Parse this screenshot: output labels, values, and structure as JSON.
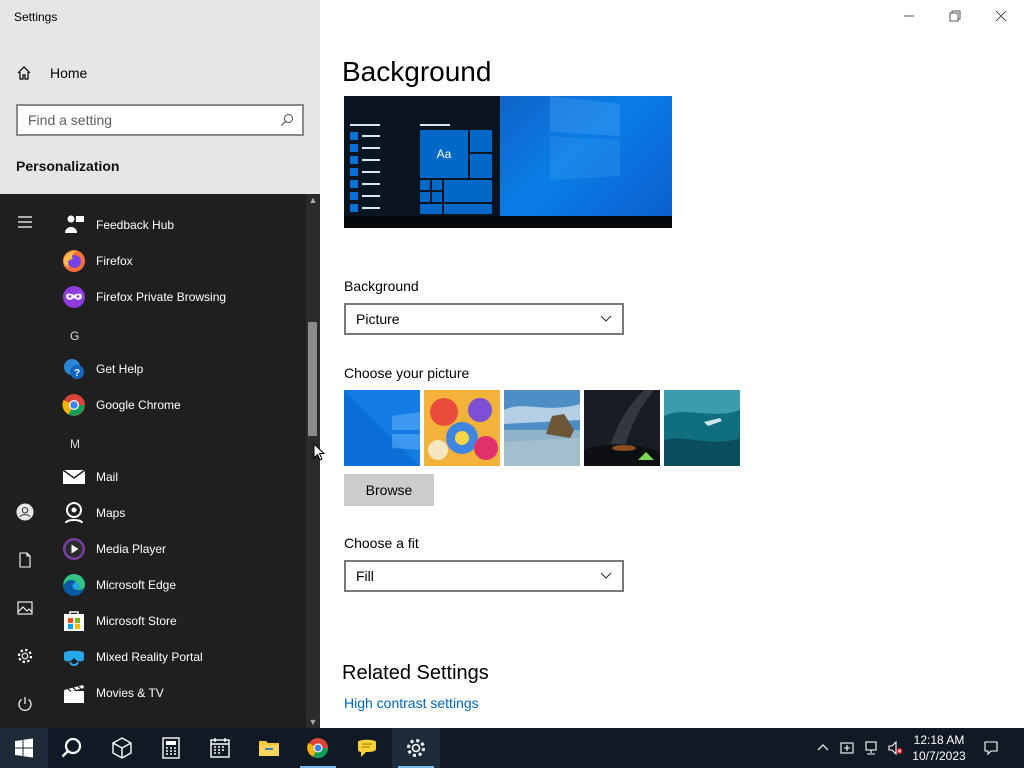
{
  "window": {
    "title": "Settings"
  },
  "sidebar": {
    "home_label": "Home",
    "search_placeholder": "Find a setting",
    "section_label": "Personalization"
  },
  "start_menu": {
    "apps": [
      {
        "name": "Feedback Hub",
        "icon": "feedback-hub-icon"
      },
      {
        "name": "Firefox",
        "icon": "firefox-icon"
      },
      {
        "name": "Firefox Private Browsing",
        "icon": "firefox-private-icon"
      },
      {
        "name": "Get Help",
        "icon": "get-help-icon"
      },
      {
        "name": "Google Chrome",
        "icon": "chrome-icon"
      },
      {
        "name": "Mail",
        "icon": "mail-icon"
      },
      {
        "name": "Maps",
        "icon": "maps-icon"
      },
      {
        "name": "Media Player",
        "icon": "media-player-icon"
      },
      {
        "name": "Microsoft Edge",
        "icon": "edge-icon"
      },
      {
        "name": "Microsoft Store",
        "icon": "store-icon"
      },
      {
        "name": "Mixed Reality Portal",
        "icon": "mixed-reality-icon"
      },
      {
        "name": "Movies & TV",
        "icon": "movies-tv-icon"
      }
    ],
    "letters": [
      "G",
      "M"
    ]
  },
  "main": {
    "page_title": "Background",
    "background_label": "Background",
    "background_value": "Picture",
    "choose_picture_label": "Choose your picture",
    "browse_label": "Browse",
    "choose_fit_label": "Choose a fit",
    "fit_value": "Fill",
    "related_heading": "Related Settings",
    "high_contrast_link": "High contrast settings",
    "preview_tile_text": "Aa"
  },
  "taskbar": {
    "time": "12:18 AM",
    "date": "10/7/2023"
  },
  "colors": {
    "accent": "#0067b8",
    "start_bg": "#1f1f1f",
    "taskbar_bg": "#101a24"
  }
}
